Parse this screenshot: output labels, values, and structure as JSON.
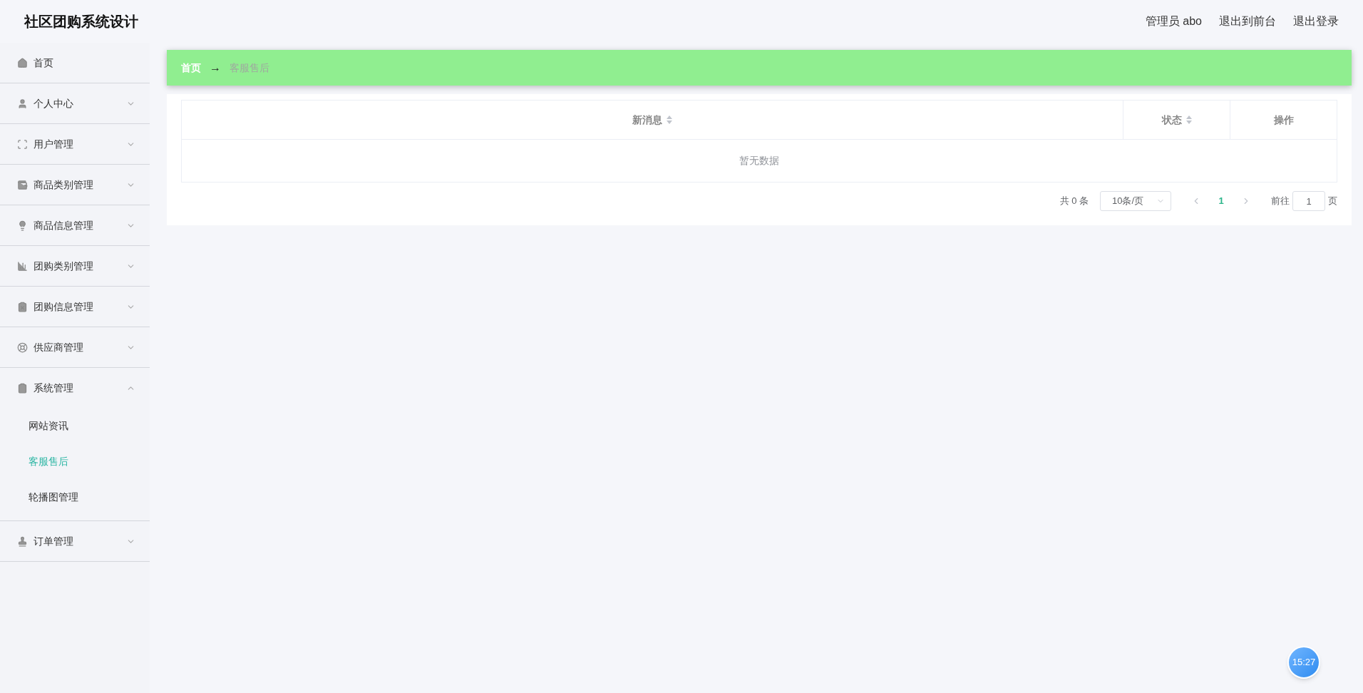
{
  "header": {
    "title": "社区团购系统设计",
    "links": [
      "管理员 abo",
      "退出到前台",
      "退出登录"
    ]
  },
  "sidebar": {
    "items": [
      {
        "label": "首页",
        "kind": "link"
      },
      {
        "label": "个人中心",
        "kind": "menu",
        "expanded": false
      },
      {
        "label": "用户管理",
        "kind": "menu",
        "expanded": false
      },
      {
        "label": "商品类别管理",
        "kind": "menu",
        "expanded": false
      },
      {
        "label": "商品信息管理",
        "kind": "menu",
        "expanded": false
      },
      {
        "label": "团购类别管理",
        "kind": "menu",
        "expanded": false
      },
      {
        "label": "团购信息管理",
        "kind": "menu",
        "expanded": false
      },
      {
        "label": "供应商管理",
        "kind": "menu",
        "expanded": false
      },
      {
        "label": "系统管理",
        "kind": "menu",
        "expanded": true,
        "children": [
          {
            "label": "网站资讯",
            "selected": false
          },
          {
            "label": "客服售后",
            "selected": true
          },
          {
            "label": "轮播图管理",
            "selected": false
          }
        ]
      },
      {
        "label": "订单管理",
        "kind": "menu",
        "expanded": false
      }
    ]
  },
  "breadcrumb": {
    "home": "首页",
    "separator": "→",
    "current": "客服售后"
  },
  "table": {
    "columns": [
      {
        "label": "新消息",
        "sortable": true
      },
      {
        "label": "状态",
        "sortable": true
      },
      {
        "label": "操作",
        "sortable": false
      }
    ],
    "empty_text": "暂无数据"
  },
  "pagination": {
    "total": "共 0 条",
    "page_size": "10条/页",
    "pages": [
      {
        "label": "1",
        "selected": true
      }
    ],
    "goto_label": "前往",
    "goto_value": "1",
    "goto_suffix": "页"
  },
  "clock": {
    "time": "15:27"
  }
}
